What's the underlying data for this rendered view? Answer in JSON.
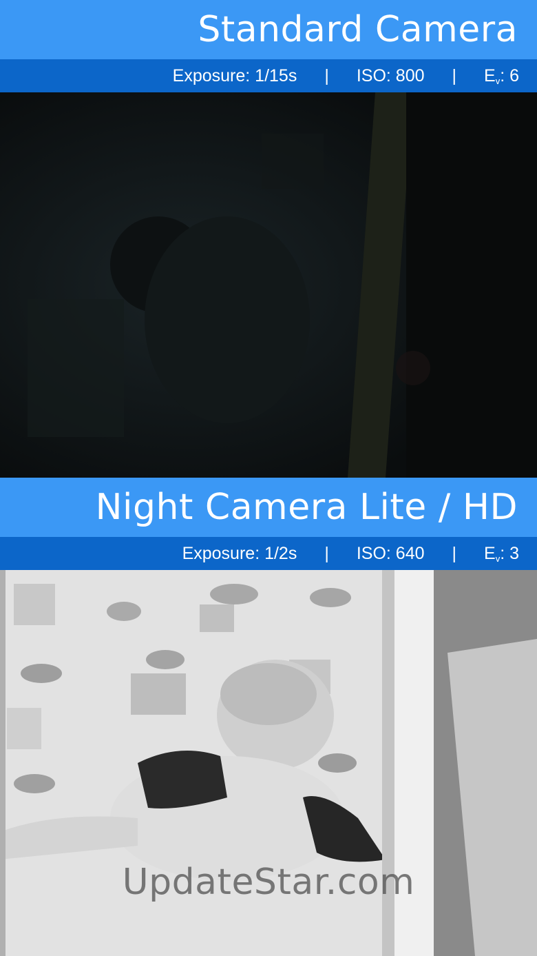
{
  "standard": {
    "title": "Standard Camera",
    "exposure": "Exposure: 1/15s",
    "iso": "ISO: 800",
    "ev_letter": "E",
    "ev_sub": "v",
    "ev_value": ": 6"
  },
  "night": {
    "title": "Night Camera Lite / HD",
    "exposure": "Exposure: 1/2s",
    "iso": "ISO: 640",
    "ev_letter": "E",
    "ev_sub": "v",
    "ev_value": ": 3"
  },
  "separator": "|",
  "watermark": "UpdateStar.com",
  "colors": {
    "title_bar": "#3b98f5",
    "stats_bar": "#0c66c9",
    "text": "#ffffff"
  }
}
